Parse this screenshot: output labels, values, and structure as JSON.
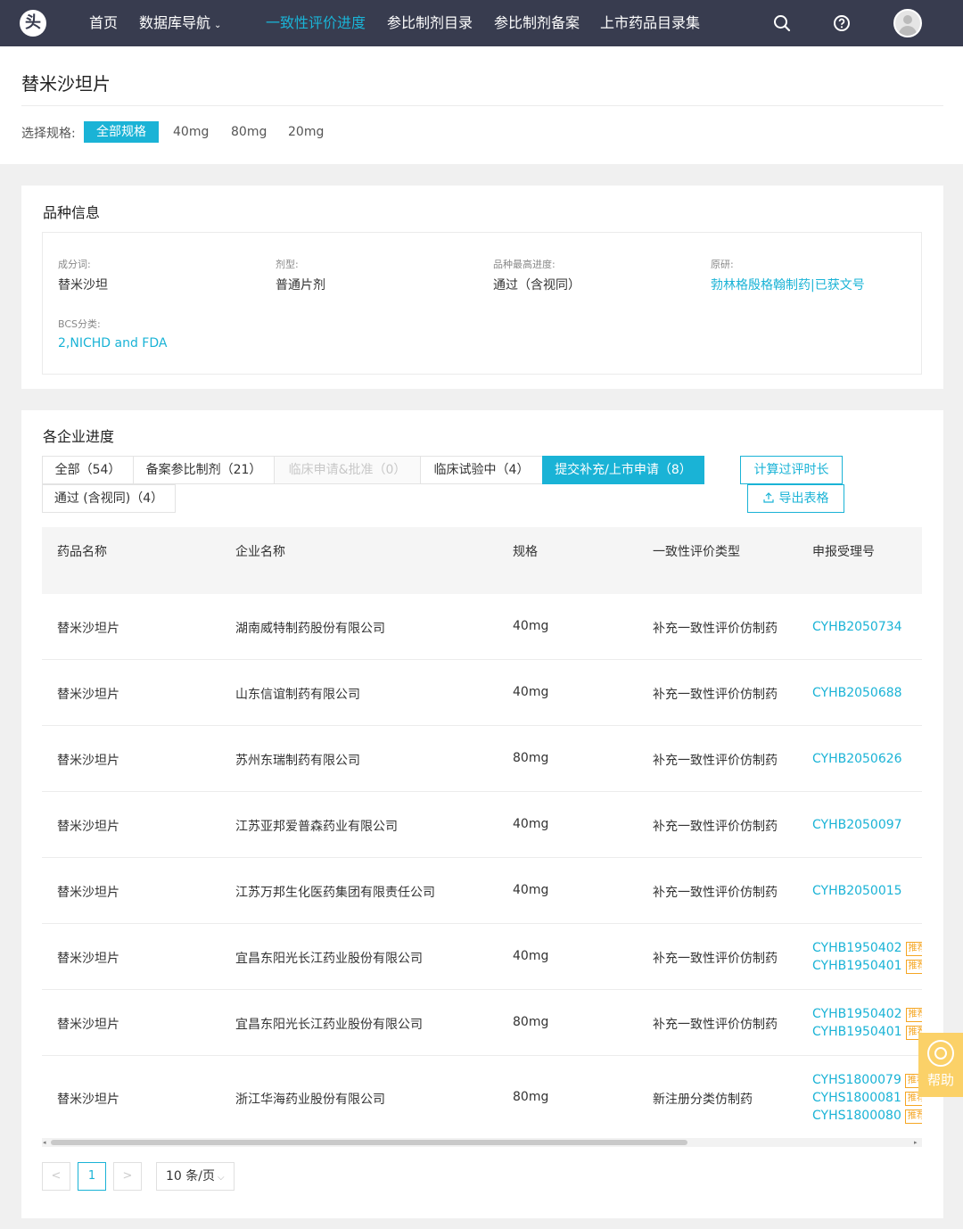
{
  "nav": {
    "logo_text": "头",
    "items": [
      {
        "label": "首页"
      },
      {
        "label": "数据库导航",
        "caret": "⌄"
      },
      {
        "label": "一致性评价进度"
      },
      {
        "label": "参比制剂目录"
      },
      {
        "label": "参比制剂备案"
      },
      {
        "label": "上市药品目录集"
      }
    ],
    "active_index": 2
  },
  "page": {
    "title": "替米沙坦片",
    "spec_label": "选择规格:",
    "spec_options": [
      "全部规格",
      "40mg",
      "80mg",
      "20mg"
    ],
    "spec_selected": "全部规格"
  },
  "info": {
    "title": "品种信息",
    "fields": [
      {
        "label": "成分词:",
        "value": "替米沙坦"
      },
      {
        "label": "剂型:",
        "value": "普通片剂"
      },
      {
        "label": "品种最高进度:",
        "value": "通过（含视同）"
      },
      {
        "label": "原研:",
        "value": "勃林格殷格翰制药|已获文号"
      },
      {
        "label": "BCS分类:",
        "value": "2,NICHD and FDA"
      }
    ]
  },
  "progress": {
    "title": "各企业进度",
    "tabs": [
      {
        "label": "全部（54）",
        "state": "normal"
      },
      {
        "label": "备案参比制剂（21）",
        "state": "normal"
      },
      {
        "label": "临床申请&批准（0）",
        "state": "disabled"
      },
      {
        "label": "临床试验中（4）",
        "state": "normal"
      },
      {
        "label": "提交补充/上市申请（8）",
        "state": "active"
      },
      {
        "label": "通过 (含视同)（4）",
        "state": "normal"
      }
    ],
    "calc_button": "计算过评时长",
    "export_button": "导出表格",
    "columns": [
      "药品名称",
      "企业名称",
      "规格",
      "一致性评价类型",
      "申报受理号"
    ],
    "rows": [
      {
        "drug": "替米沙坦片",
        "company": "湖南威特制药股份有限公司",
        "spec": "40mg",
        "type": "补充一致性评价仿制药",
        "codes": [
          {
            "code": "CYHB2050734"
          }
        ]
      },
      {
        "drug": "替米沙坦片",
        "company": "山东信谊制药有限公司",
        "spec": "40mg",
        "type": "补充一致性评价仿制药",
        "codes": [
          {
            "code": "CYHB2050688"
          }
        ]
      },
      {
        "drug": "替米沙坦片",
        "company": "苏州东瑞制药有限公司",
        "spec": "80mg",
        "type": "补充一致性评价仿制药",
        "codes": [
          {
            "code": "CYHB2050626"
          }
        ]
      },
      {
        "drug": "替米沙坦片",
        "company": "江苏亚邦爱普森药业有限公司",
        "spec": "40mg",
        "type": "补充一致性评价仿制药",
        "codes": [
          {
            "code": "CYHB2050097"
          }
        ]
      },
      {
        "drug": "替米沙坦片",
        "company": "江苏万邦生化医药集团有限责任公司",
        "spec": "40mg",
        "type": "补充一致性评价仿制药",
        "codes": [
          {
            "code": "CYHB2050015"
          }
        ]
      },
      {
        "drug": "替米沙坦片",
        "company": "宜昌东阳光长江药业股份有限公司",
        "spec": "40mg",
        "type": "补充一致性评价仿制药",
        "codes": [
          {
            "code": "CYHB1950402",
            "tag": "推荐"
          },
          {
            "code": "CYHB1950401",
            "tag": "推荐"
          }
        ]
      },
      {
        "drug": "替米沙坦片",
        "company": "宜昌东阳光长江药业股份有限公司",
        "spec": "80mg",
        "type": "补充一致性评价仿制药",
        "codes": [
          {
            "code": "CYHB1950402",
            "tag": "推荐"
          },
          {
            "code": "CYHB1950401",
            "tag": "推荐"
          }
        ]
      },
      {
        "drug": "替米沙坦片",
        "company": "浙江华海药业股份有限公司",
        "spec": "80mg",
        "type": "新注册分类仿制药",
        "codes": [
          {
            "code": "CYHS1800079",
            "tag": "推荐"
          },
          {
            "code": "CYHS1800081",
            "tag": "推荐"
          },
          {
            "code": "CYHS1800080",
            "tag": "推荐"
          }
        ]
      }
    ]
  },
  "pagination": {
    "prev": "<",
    "current_page": "1",
    "next": ">",
    "page_size": "10 条/页"
  },
  "help": {
    "label": "帮助"
  },
  "colors": {
    "accent": "#1ab3d6",
    "nav_bg": "#383c4f",
    "tag": "#f5a623",
    "help_bg": "#fbd168"
  }
}
